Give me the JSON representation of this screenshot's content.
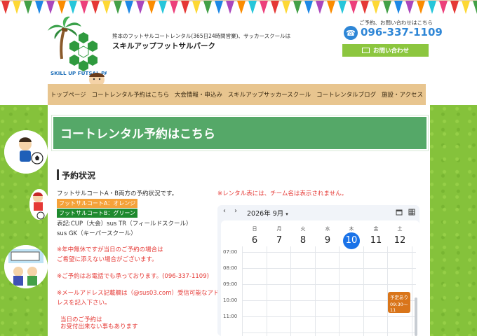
{
  "header": {
    "tagline": "熊本のフットサルコートレンタル(365日24時間営業)、サッカースクールは",
    "site_name": "スキルアップフットサルパーク",
    "logo_text": "SKILL UP FUTSAL PARK",
    "contact_label": "ご予約、お問い合わせはこちら",
    "phone": "096-337-1109",
    "contact_button": "お問い合わせ"
  },
  "nav": {
    "items": [
      {
        "label": "トップページ"
      },
      {
        "label": "コートレンタル予約はこちら"
      },
      {
        "label": "大会情報・申込み"
      },
      {
        "label": "スキルアップサッカースクール"
      },
      {
        "label": "コートレンタルブログ"
      },
      {
        "label": "施設・アクセス"
      }
    ]
  },
  "page": {
    "title": "コートレンタル予約はこちら",
    "section_title": "予約状況",
    "intro": "フットサルコートA・B両方の予約状況です。",
    "court_a": "フットサルコートA：オレンジ",
    "court_b": "フットサルコートB：グリーン",
    "legend_1": "表記:CUP（大会）sus TR（フィールドスクール）",
    "legend_2": "sus GK（キーパースクール）",
    "notice_1a": "※年中無休ですが当日のご予約の場合は",
    "notice_1b": "ご希望に添えない場合がございます。",
    "notice_2": "※ご予約はお電話でも承っております。(096-337-1109)",
    "notice_3a": "※メールアドレス記載欄は（@sus03.com）受信可能なアド",
    "notice_3b": "レスを記入下さい。",
    "notice_4a": "当日のご予約は",
    "notice_4b": "お受付出来ない事もあります",
    "rental_note": "※レンタル表には、チーム名は表示されません。"
  },
  "calendar": {
    "prev": "‹",
    "next": "›",
    "month_label": "2026年 9月",
    "days": [
      {
        "dow": "日",
        "num": "6"
      },
      {
        "dow": "月",
        "num": "7"
      },
      {
        "dow": "火",
        "num": "8"
      },
      {
        "dow": "水",
        "num": "9"
      },
      {
        "dow": "木",
        "num": "10"
      },
      {
        "dow": "金",
        "num": "11"
      },
      {
        "dow": "土",
        "num": "12"
      }
    ],
    "today_index": 4,
    "times": [
      "07:00",
      "08:00",
      "09:00",
      "10:00",
      "11:00"
    ],
    "event": {
      "title": "予定あり",
      "time": "09:30～11"
    },
    "colors": {
      "today": "#1a73e8",
      "event": "#d9751a"
    }
  },
  "colors": {
    "accent_green": "#55a868",
    "phone_blue": "#2e86d6",
    "contact_green": "#8cc63f",
    "nav_tan": "#e8c58f",
    "grass": "#85c23b",
    "alert_red": "#e53935",
    "court_a_orange": "#f5a23a",
    "court_b_green": "#1e8a2e"
  }
}
